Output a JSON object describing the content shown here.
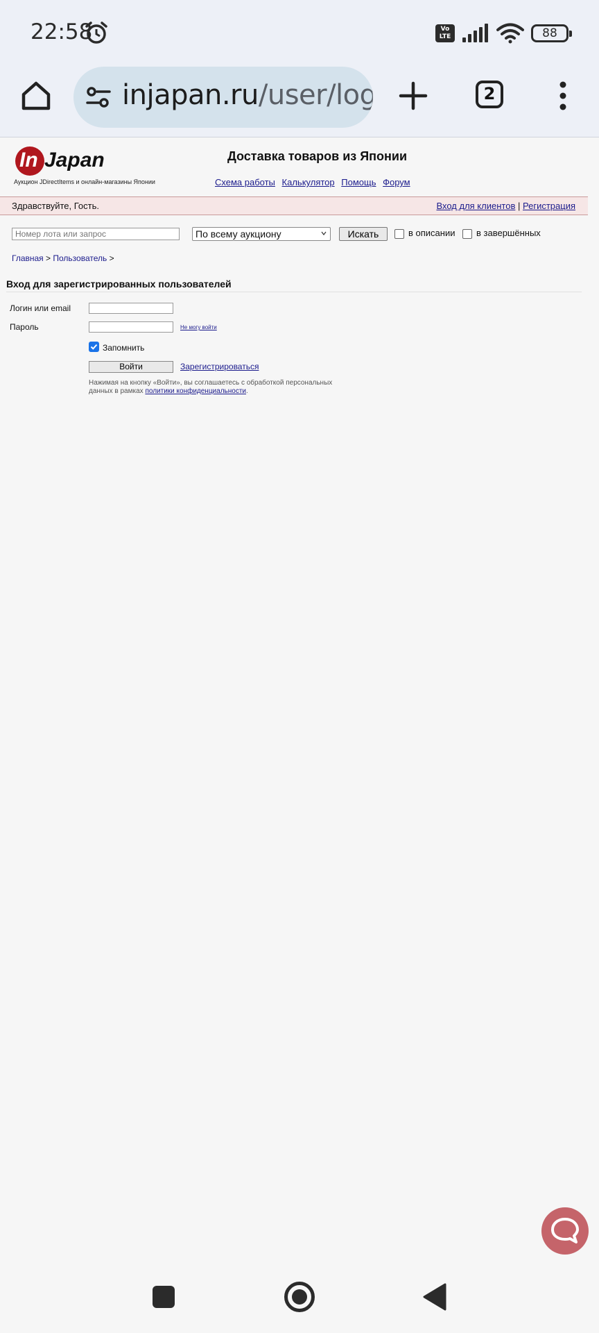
{
  "status_bar": {
    "time": "22:58",
    "volte": "Vo LTE",
    "battery": "88",
    "icons": [
      "alarm-icon",
      "signal-icon",
      "wifi-icon",
      "battery-icon"
    ]
  },
  "browser": {
    "url_host": "injapan.ru",
    "url_path": "/user/login",
    "tab_count": "2",
    "icons": [
      "home-icon",
      "tune-icon",
      "plus-icon",
      "tabs-icon",
      "more-vert-icon"
    ]
  },
  "site": {
    "logo_in": "In",
    "logo_japan": "Japan",
    "logo_subtitle": "Аукцион JDirectItems и онлайн-магазины Японии",
    "title": "Доставка товаров из Японии",
    "nav": [
      "Схема работы",
      "Калькулятор",
      "Помощь",
      "Форум"
    ]
  },
  "greeting": {
    "text": "Здравствуйте, Гость.",
    "login_link": "Вход для клиентов",
    "separator": "|",
    "register_link": "Регистрация"
  },
  "search": {
    "placeholder": "Номер лота или запрос",
    "scope_selected": "По всему аукциону",
    "button": "Искать",
    "in_description": "в описании",
    "in_completed": "в завершённых"
  },
  "breadcrumb": {
    "home": "Главная",
    "sep": ">",
    "user": "Пользователь"
  },
  "login_form": {
    "title": "Вход для зарегистрированных пользователей",
    "login_label": "Логин или email",
    "password_label": "Пароль",
    "forgot_link": "Не могу войти",
    "remember_label": "Запомнить",
    "remember_checked": true,
    "submit": "Войти",
    "register_link": "Зарегистрироваться",
    "notice_text": "Нажимая на кнопку «Войти», вы соглашаетесь с обработкой персональных данных в рамках ",
    "notice_link": "политики конфиденциальности",
    "notice_end": "."
  },
  "colors": {
    "accent_red": "#b0171e",
    "link": "#1b1b8c",
    "greet_bar": "#f6e6e6",
    "chat_fab": "#c5646a",
    "checkbox_blue": "#1a73e8"
  }
}
